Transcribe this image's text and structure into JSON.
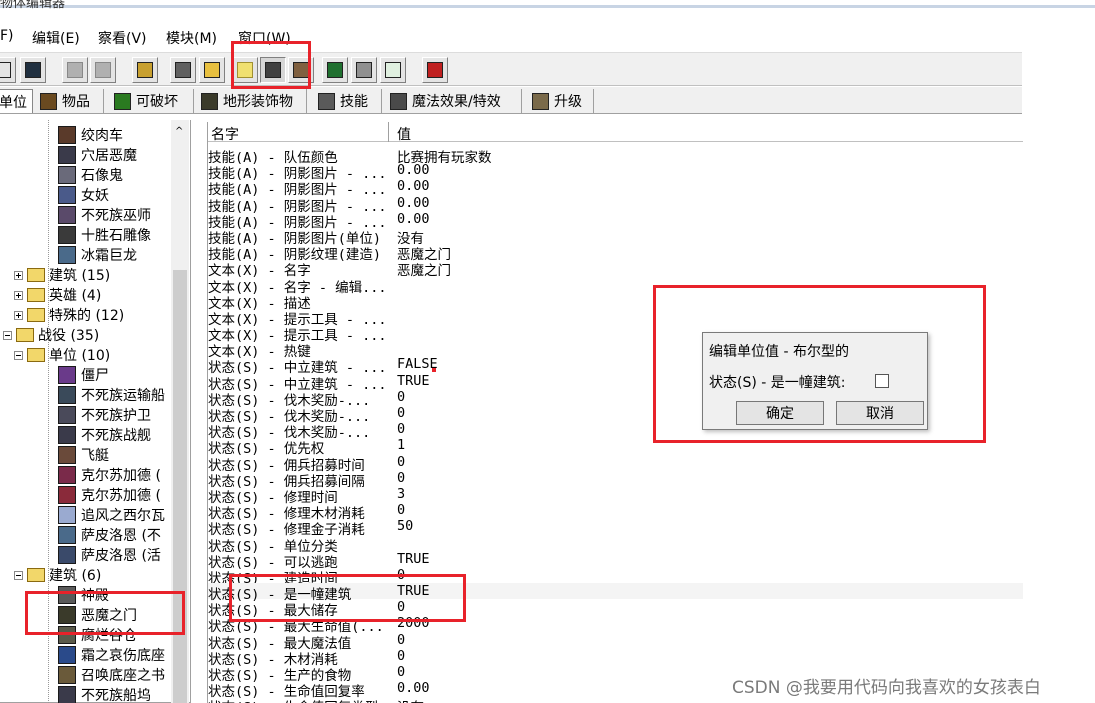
{
  "window": {
    "title": "物体编辑器"
  },
  "menu": [
    {
      "label": "F)"
    },
    {
      "label": "编辑(E)"
    },
    {
      "label": "察看(V)"
    },
    {
      "label": "模块(M)"
    },
    {
      "label": "窗口(W)"
    }
  ],
  "tabs": [
    {
      "label": "单位"
    },
    {
      "label": "物品"
    },
    {
      "label": "可破坏"
    },
    {
      "label": "地形装饰物"
    },
    {
      "label": "技能"
    },
    {
      "label": "魔法效果/特效"
    },
    {
      "label": "升级"
    }
  ],
  "tree": {
    "items": [
      {
        "label": "绞肉车",
        "kind": "unit"
      },
      {
        "label": "穴居恶魔",
        "kind": "unit"
      },
      {
        "label": "石像鬼",
        "kind": "unit"
      },
      {
        "label": "女妖",
        "kind": "unit"
      },
      {
        "label": "不死族巫师",
        "kind": "unit"
      },
      {
        "label": "十胜石雕像",
        "kind": "unit"
      },
      {
        "label": "冰霜巨龙",
        "kind": "unit"
      },
      {
        "label": "建筑 (15)",
        "kind": "folder"
      },
      {
        "label": "英雄 (4)",
        "kind": "folder"
      },
      {
        "label": "特殊的 (12)",
        "kind": "folder"
      },
      {
        "label": "战役 (35)",
        "kind": "folder"
      },
      {
        "label": "单位 (10)",
        "kind": "folder"
      },
      {
        "label": "僵尸",
        "kind": "unit"
      },
      {
        "label": "不死族运输船",
        "kind": "unit"
      },
      {
        "label": "不死族护卫",
        "kind": "unit"
      },
      {
        "label": "不死族战舰",
        "kind": "unit"
      },
      {
        "label": "飞艇",
        "kind": "unit"
      },
      {
        "label": "克尔苏加德 (",
        "kind": "unit"
      },
      {
        "label": "克尔苏加德 (",
        "kind": "unit"
      },
      {
        "label": "追风之西尔瓦",
        "kind": "unit"
      },
      {
        "label": "萨皮洛恩 (不",
        "kind": "unit"
      },
      {
        "label": "萨皮洛恩 (活",
        "kind": "unit"
      },
      {
        "label": "建筑 (6)",
        "kind": "folder"
      },
      {
        "label": "神殿",
        "kind": "unit"
      },
      {
        "label": "恶魔之门",
        "kind": "unit"
      },
      {
        "label": "腐烂谷仓",
        "kind": "unit"
      },
      {
        "label": "霜之哀伤底座",
        "kind": "unit"
      },
      {
        "label": "召唤底座之书",
        "kind": "unit"
      },
      {
        "label": "不死族船坞",
        "kind": "unit"
      }
    ]
  },
  "properties": {
    "header_name": "名字",
    "header_value": "值",
    "rows": [
      {
        "name": "技能(A) - 队伍颜色",
        "value": "比赛拥有玩家数"
      },
      {
        "name": "技能(A) - 阴影图片 - ...",
        "value": "0.00"
      },
      {
        "name": "技能(A) - 阴影图片 - ...",
        "value": "0.00"
      },
      {
        "name": "技能(A) - 阴影图片 - ...",
        "value": "0.00"
      },
      {
        "name": "技能(A) - 阴影图片 - ...",
        "value": "0.00"
      },
      {
        "name": "技能(A) - 阴影图片(单位)",
        "value": "没有"
      },
      {
        "name": "技能(A) - 阴影纹理(建造)",
        "value": "恶魔之门"
      },
      {
        "name": "文本(X) - 名字",
        "value": "恶魔之门"
      },
      {
        "name": "文本(X) - 名字 - 编辑...",
        "value": ""
      },
      {
        "name": "文本(X) - 描述",
        "value": ""
      },
      {
        "name": "文本(X) - 提示工具 - ...",
        "value": ""
      },
      {
        "name": "文本(X) - 提示工具 - ...",
        "value": ""
      },
      {
        "name": "文本(X) - 热键",
        "value": ""
      },
      {
        "name": "状态(S) - 中立建筑 - ...",
        "value": "FALSE"
      },
      {
        "name": "状态(S) - 中立建筑 - ...",
        "value": "TRUE"
      },
      {
        "name": "状态(S) - 伐木奖励-...",
        "value": "0"
      },
      {
        "name": "状态(S) - 伐木奖励-...",
        "value": "0"
      },
      {
        "name": "状态(S) - 伐木奖励-...",
        "value": "0"
      },
      {
        "name": "状态(S) - 优先权",
        "value": "1"
      },
      {
        "name": "状态(S) - 佣兵招募时间",
        "value": "0"
      },
      {
        "name": "状态(S) - 佣兵招募间隔",
        "value": "0"
      },
      {
        "name": "状态(S) - 修理时间",
        "value": "3"
      },
      {
        "name": "状态(S) - 修理木材消耗",
        "value": "0"
      },
      {
        "name": "状态(S) - 修理金子消耗",
        "value": "50"
      },
      {
        "name": "状态(S) - 单位分类",
        "value": ""
      },
      {
        "name": "状态(S) - 可以逃跑",
        "value": "TRUE"
      },
      {
        "name": "状态(S) - 建造时间",
        "value": "0"
      },
      {
        "name": "状态(S) - 是一幢建筑",
        "value": "TRUE"
      },
      {
        "name": "状态(S) - 最大储存",
        "value": "0"
      },
      {
        "name": "状态(S) - 最大生命值(...",
        "value": "2000"
      },
      {
        "name": "状态(S) - 最大魔法值",
        "value": "0"
      },
      {
        "name": "状态(S) - 木材消耗",
        "value": "0"
      },
      {
        "name": "状态(S) - 生产的食物",
        "value": "0"
      },
      {
        "name": "状态(S) - 生命值回复率",
        "value": "0.00"
      },
      {
        "name": "状态(S) - 生命值回复类型",
        "value": "没有"
      }
    ]
  },
  "dialog": {
    "title": "编辑单位值 - 布尔型的",
    "field_label": "状态(S) - 是一幢建筑:",
    "checked": false,
    "ok_label": "确定",
    "cancel_label": "取消"
  },
  "watermark": "CSDN @我要用代码向我喜欢的女孩表白"
}
